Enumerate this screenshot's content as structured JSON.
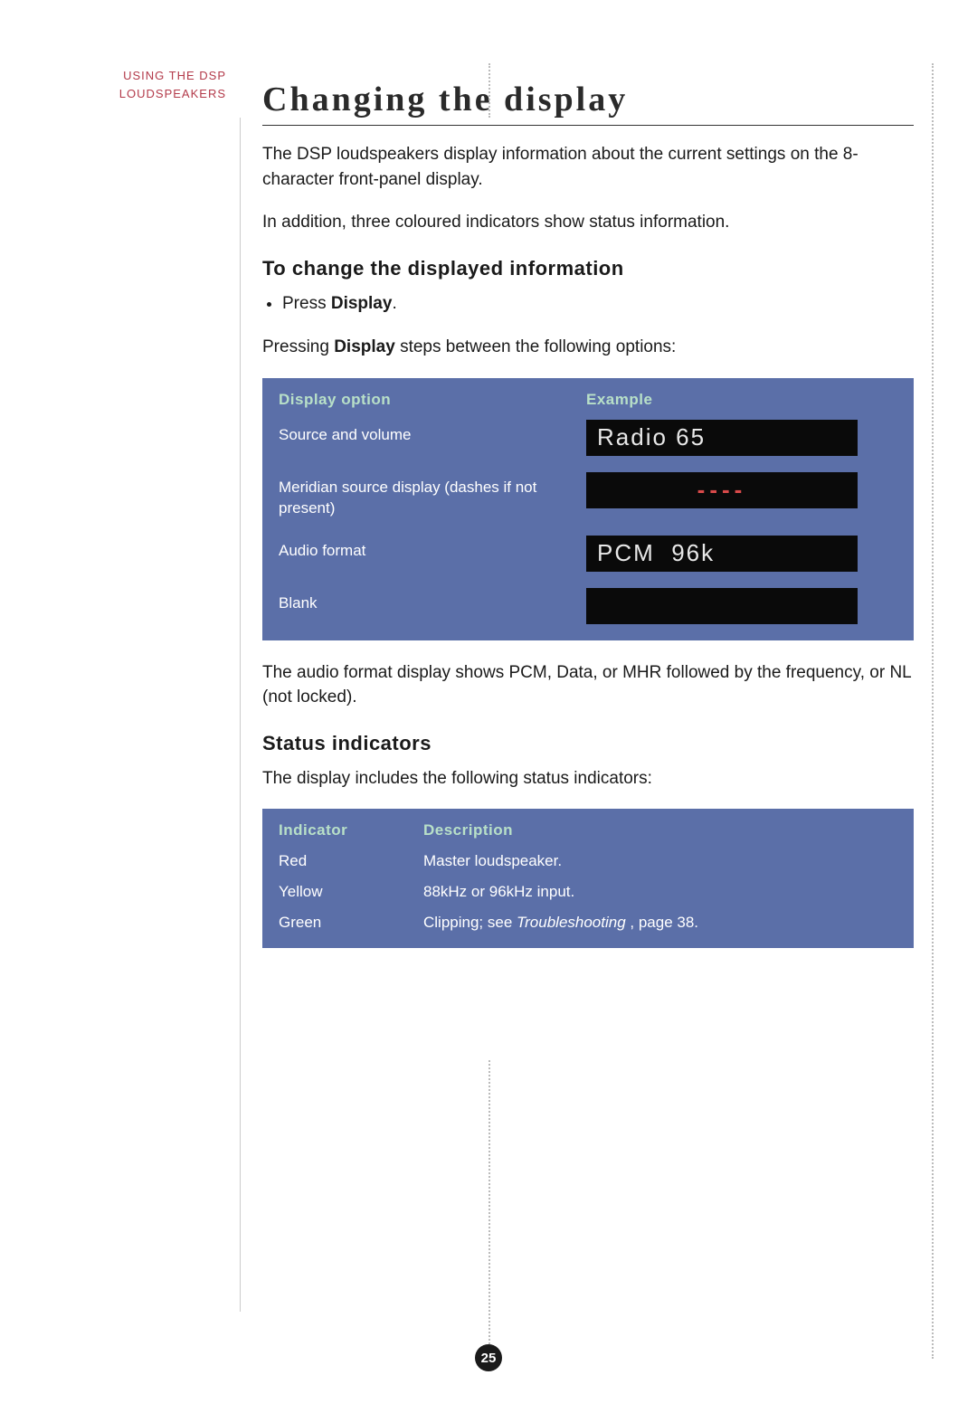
{
  "sidebar": {
    "line1": "USING THE DSP",
    "line2": "LOUDSPEAKERS"
  },
  "title": "Changing the display",
  "intro": {
    "p1": "The DSP loudspeakers display information about the current settings on the 8-character front-panel display.",
    "p2": "In addition, three coloured indicators show status information."
  },
  "section1": {
    "heading": "To change the displayed information",
    "bullet_prefix": "Press ",
    "bullet_bold": "Display",
    "bullet_suffix": ".",
    "followup_prefix": "Pressing ",
    "followup_bold": "Display",
    "followup_suffix": " steps between the following options:"
  },
  "display_table": {
    "header_option": "Display option",
    "header_example": "Example",
    "rows": [
      {
        "option": "Source and volume",
        "lcd": "Radio 65",
        "lcd_class": ""
      },
      {
        "option": "Meridian source display (dashes if not present)",
        "lcd": "----",
        "lcd_class": "red"
      },
      {
        "option": "Audio format",
        "lcd": "PCM  96k",
        "lcd_class": ""
      },
      {
        "option": "Blank",
        "lcd": "",
        "lcd_class": ""
      }
    ]
  },
  "after_table": "The audio format display shows PCM, Data, or MHR followed by the frequency, or NL (not locked).",
  "section2": {
    "heading": "Status indicators",
    "intro": "The display includes the following status indicators:"
  },
  "indicator_table": {
    "header_indicator": "Indicator",
    "header_description": "Description",
    "rows": [
      {
        "indicator": "Red",
        "desc_pre": "Master loudspeaker.",
        "desc_ital": "",
        "desc_post": ""
      },
      {
        "indicator": "Yellow",
        "desc_pre": "88kHz or 96kHz input.",
        "desc_ital": "",
        "desc_post": ""
      },
      {
        "indicator": "Green",
        "desc_pre": "Clipping; see ",
        "desc_ital": "Troubleshooting",
        "desc_post": " , page 38."
      }
    ]
  },
  "page_number": "25"
}
